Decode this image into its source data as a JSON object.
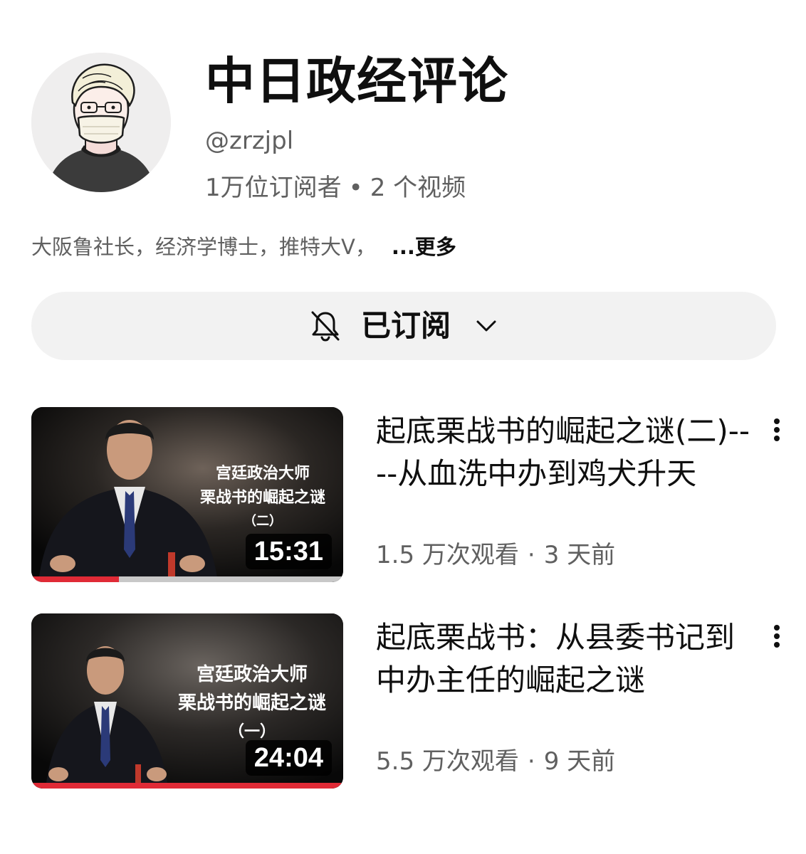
{
  "channel": {
    "name": "中日政经评论",
    "handle": "@zrzjpl",
    "subscribers": "1万位订阅者",
    "video_count": "2 个视频",
    "separator": "•",
    "description": "大阪鲁社长，经济学博士，推特大V，",
    "more_label": "...更多",
    "avatar_icon": "person-with-mask-illustration"
  },
  "subscribe": {
    "label": "已订阅",
    "bell_icon": "bell-off-icon",
    "dropdown_icon": "chevron-down-icon"
  },
  "videos": [
    {
      "title": "起底栗战书的崛起之谜(二)----从血洗中办到鸡犬升天",
      "views": "1.5 万次观看",
      "age": "3 天前",
      "separator": "·",
      "duration": "15:31",
      "thumb_lines": [
        "宫廷政治大师",
        "栗战书的崛起之谜",
        "（二）"
      ],
      "watched_fraction": 0.28,
      "menu_icon": "more-vertical-icon"
    },
    {
      "title": "起底栗战书：从县委书记到中办主任的崛起之谜",
      "views": "5.5 万次观看",
      "age": "9 天前",
      "separator": "·",
      "duration": "24:04",
      "thumb_lines": [
        "宫廷政治大师",
        "栗战书的崛起之谜",
        "（一）"
      ],
      "watched_fraction": 1.0,
      "menu_icon": "more-vertical-icon"
    }
  ],
  "colors": {
    "progress": "#e02a36",
    "secondary_text": "#606060",
    "button_bg": "#f2f2f2"
  }
}
